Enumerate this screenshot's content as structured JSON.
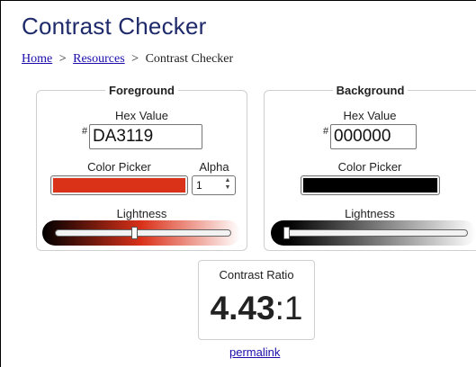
{
  "page": {
    "title": "Contrast Checker"
  },
  "breadcrumb": {
    "home": "Home",
    "sep1": ">",
    "resources": "Resources",
    "sep2": ">",
    "current": "Contrast Checker"
  },
  "foreground": {
    "legend": "Foreground",
    "hex_label": "Hex Value",
    "hash": "#",
    "hex_value": "DA3119",
    "picker_label": "Color Picker",
    "alpha_label": "Alpha",
    "alpha_value": "1",
    "lightness_label": "Lightness",
    "color": "#DA3119",
    "lightness_level": 0.45
  },
  "background": {
    "legend": "Background",
    "hex_label": "Hex Value",
    "hash": "#",
    "hex_value": "000000",
    "picker_label": "Color Picker",
    "lightness_label": "Lightness",
    "color": "#000000",
    "lightness_level": 0.0
  },
  "contrast": {
    "title": "Contrast Ratio",
    "ratio_main": "4.43",
    "ratio_suffix": ":1"
  },
  "permalink": "permalink",
  "colors": {
    "title": "#1f2a6b",
    "link": "#1a0dab",
    "border": "#cfcfcf"
  }
}
